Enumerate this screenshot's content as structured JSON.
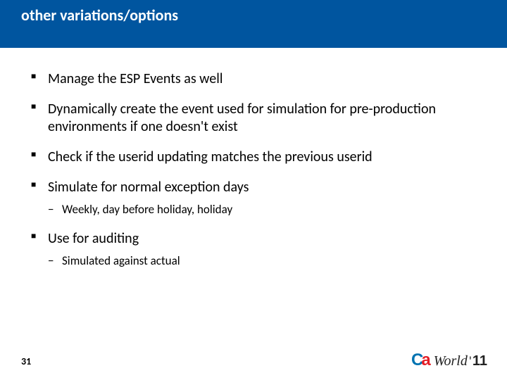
{
  "title": "other variations/options",
  "bullets": [
    {
      "text": "Manage the ESP Events as well"
    },
    {
      "text": "Dynamically create the event used for simulation for pre-production environments if one doesn't exist"
    },
    {
      "text": "Check if the userid updating matches the previous userid"
    },
    {
      "text": "Simulate for normal exception days",
      "sub": [
        "Weekly, day before holiday, holiday"
      ]
    },
    {
      "text": "Use for auditing",
      "sub": [
        "Simulated against actual"
      ]
    }
  ],
  "page_number": "31",
  "logo": {
    "ca_c": "C",
    "ca_a": "a",
    "world": "World",
    "apos": "'",
    "year": "11"
  }
}
